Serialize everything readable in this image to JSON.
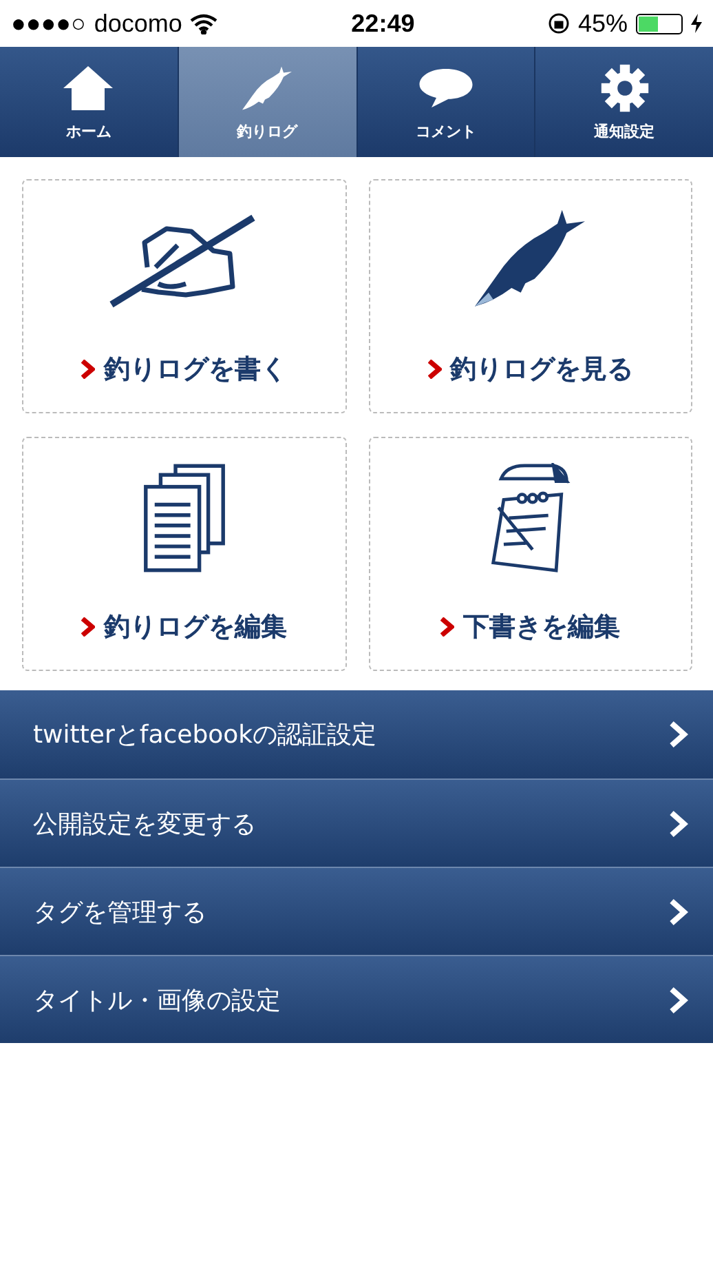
{
  "status_bar": {
    "signal": "●●●●○",
    "carrier": "docomo",
    "time": "22:49",
    "battery": "45%"
  },
  "tabs": [
    {
      "label": "ホーム",
      "kind": "home",
      "selected": false
    },
    {
      "label": "釣りログ",
      "kind": "fish",
      "selected": true
    },
    {
      "label": "コメント",
      "kind": "comment",
      "selected": false
    },
    {
      "label": "通知設定",
      "kind": "gear",
      "selected": false
    }
  ],
  "tiles": [
    {
      "label": "釣りログを書く",
      "kind": "write"
    },
    {
      "label": "釣りログを見る",
      "kind": "fish"
    },
    {
      "label": "釣りログを編集",
      "kind": "documents"
    },
    {
      "label": "下書きを編集",
      "kind": "notepad"
    }
  ],
  "menu": [
    {
      "label": "twitterとfacebookの認証設定"
    },
    {
      "label": "公開設定を変更する"
    },
    {
      "label": "タグを管理する"
    },
    {
      "label": "タイトル・画像の設定"
    }
  ]
}
